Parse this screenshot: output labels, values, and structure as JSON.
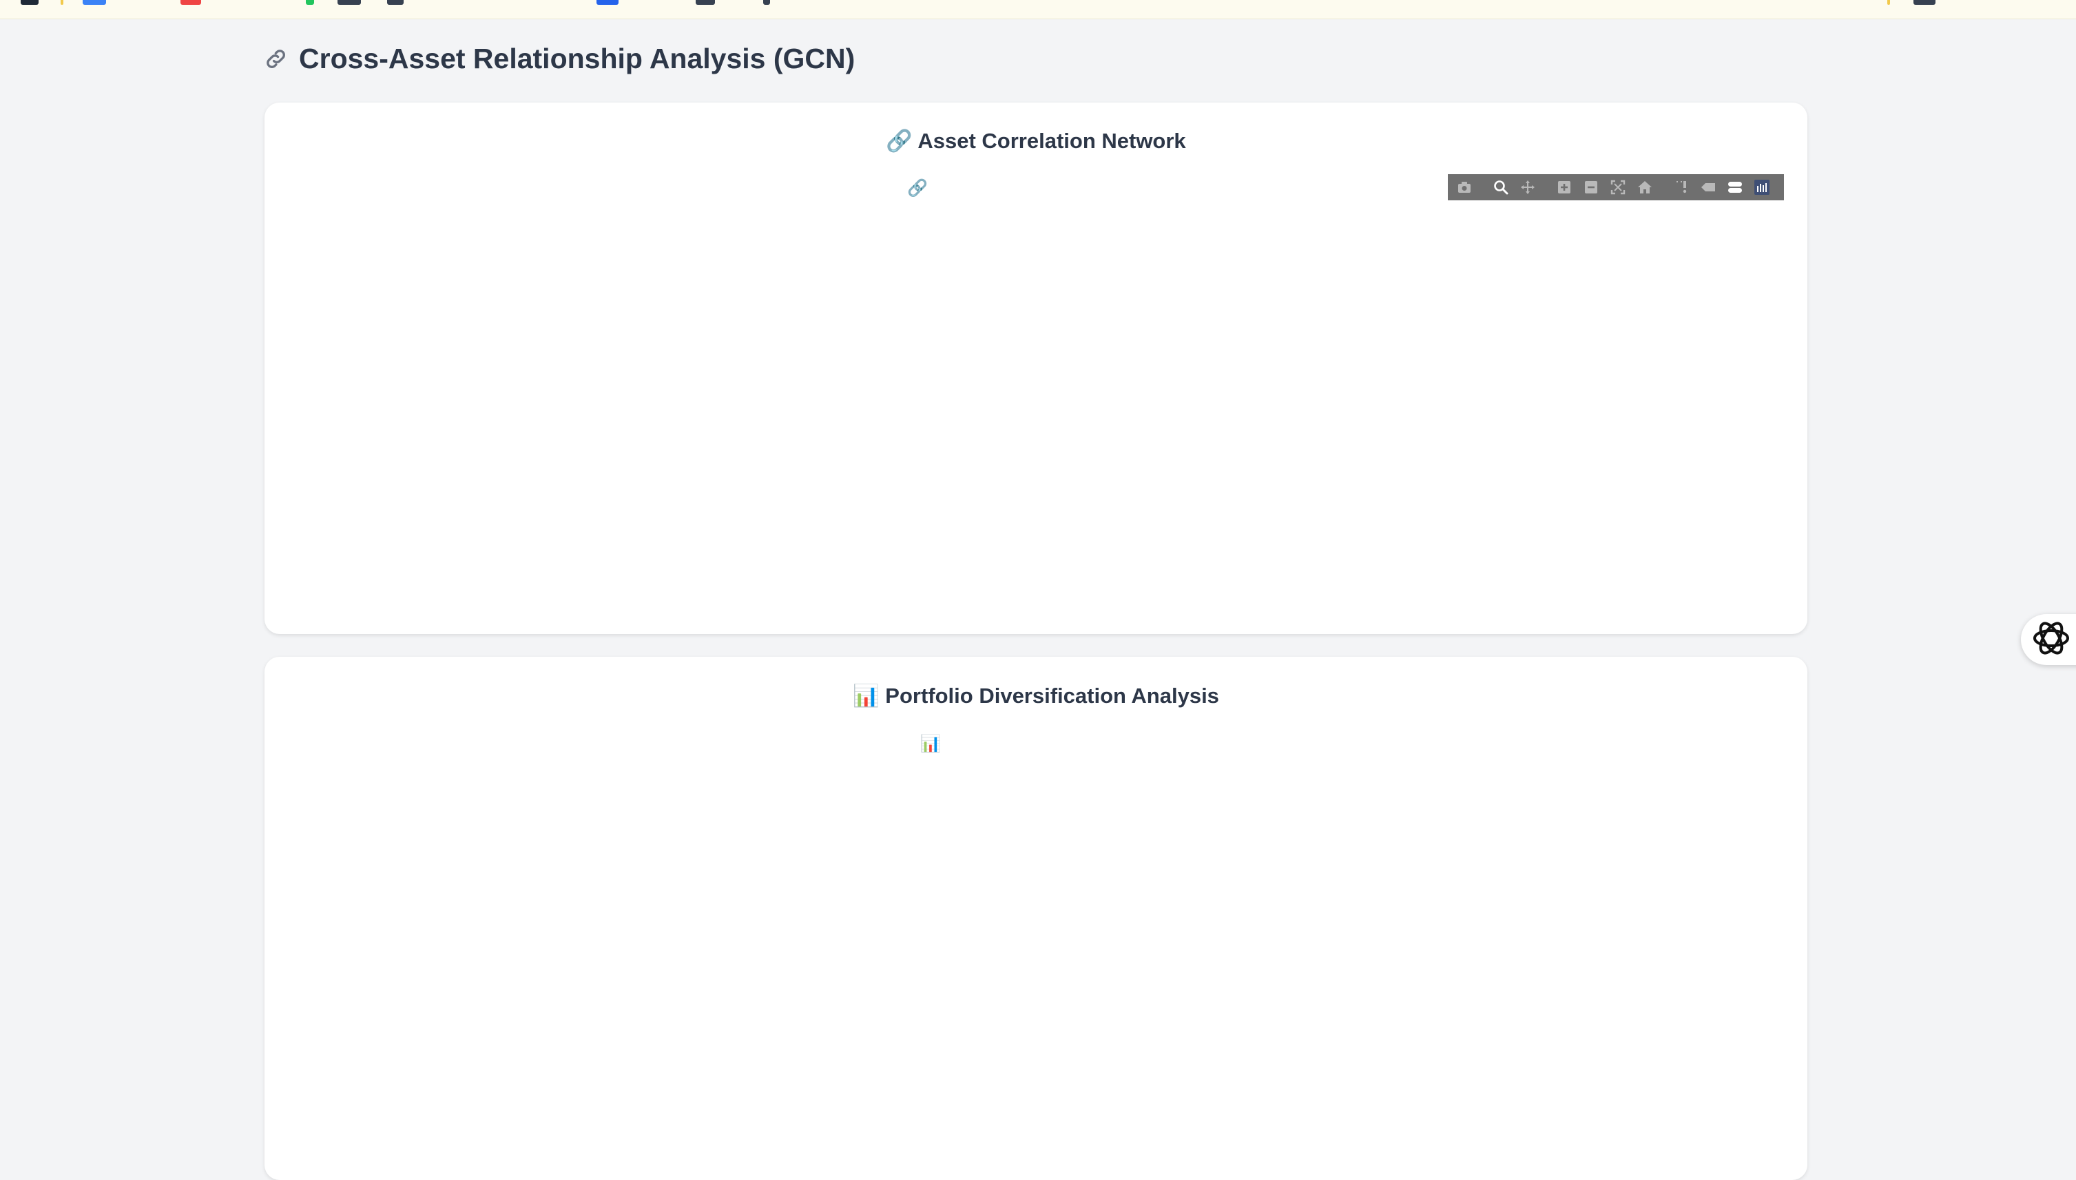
{
  "header": {
    "title": "Cross-Asset Relationship Analysis (GCN)",
    "title_icon": "link-icon"
  },
  "network_card": {
    "title": "🔗 Asset Correlation Network",
    "placeholder_glyph": "🔗"
  },
  "diversification_card": {
    "title": "📊 Portfolio Diversification Analysis",
    "placeholder_glyph": "📊"
  },
  "modebar": {
    "buttons": [
      {
        "name": "camera-icon",
        "title": "Download plot as a png"
      },
      {
        "name": "zoom-icon",
        "title": "Zoom"
      },
      {
        "name": "pan-icon",
        "title": "Pan"
      },
      {
        "name": "zoom-in-icon",
        "title": "Zoom in"
      },
      {
        "name": "zoom-out-icon",
        "title": "Zoom out"
      },
      {
        "name": "autoscale-icon",
        "title": "Autoscale"
      },
      {
        "name": "home-icon",
        "title": "Reset axes"
      },
      {
        "name": "spike-lines-icon",
        "title": "Toggle Spike Lines"
      },
      {
        "name": "hover-closest-icon",
        "title": "Show closest data on hover"
      },
      {
        "name": "hover-compare-icon",
        "title": "Compare data on hover"
      },
      {
        "name": "plotly-logo-icon",
        "title": "Produced with Plotly"
      }
    ]
  },
  "colors": {
    "page_bg": "#f3f4f6",
    "card_bg": "#ffffff",
    "heading": "#2d3748",
    "modebar_bg": "#6f6f6f",
    "topbar_bg": "#fdfbef"
  }
}
